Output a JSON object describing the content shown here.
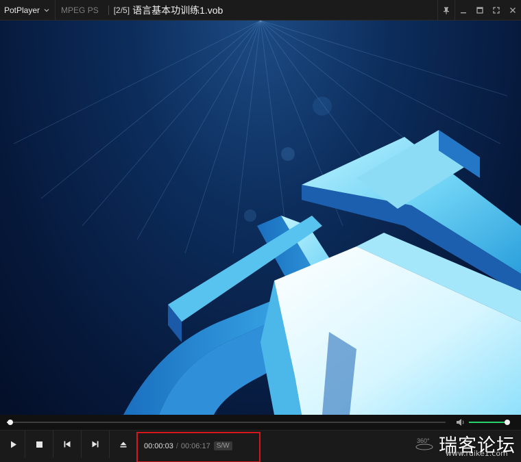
{
  "titlebar": {
    "app_name": "PotPlayer",
    "codec": "MPEG PS",
    "playlist_position": "[2/5]",
    "file_name": "语言基本功训练1.vob"
  },
  "playback": {
    "current_time": "00:00:03",
    "separator": "/",
    "total_time": "00:06:17",
    "decoder_badge": "S/W",
    "progress_fraction": 0.008,
    "volume_fraction": 0.97
  },
  "controls": {
    "vr_label": "360°"
  },
  "watermark": {
    "main": "瑞客论坛",
    "sub": "www.ruike1.com"
  },
  "colors": {
    "titlebar_bg": "#1b1b1b",
    "controlbar_bg": "#1a1a1a",
    "volume_accent": "#27d26b",
    "highlight_border": "#d5171b"
  }
}
